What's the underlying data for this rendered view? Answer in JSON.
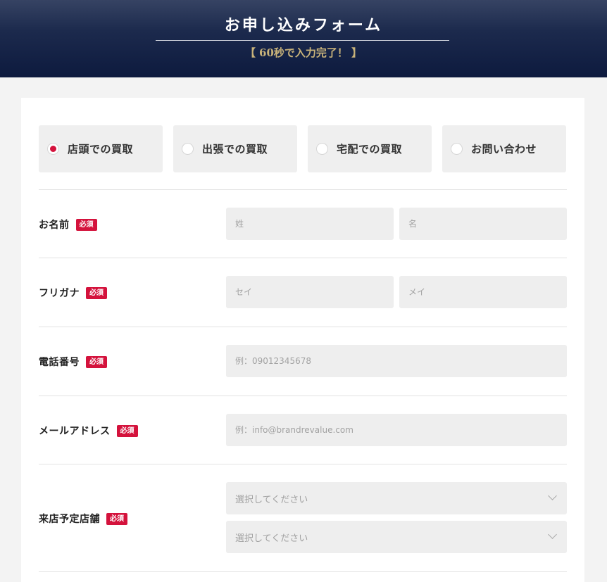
{
  "header": {
    "title": "お申し込みフォーム",
    "subtitle": "【 60秒で入力完了！ 】"
  },
  "options": [
    {
      "label": "店頭での買取",
      "selected": true
    },
    {
      "label": "出張での買取",
      "selected": false
    },
    {
      "label": "宅配での買取",
      "selected": false
    },
    {
      "label": "お問い合わせ",
      "selected": false
    }
  ],
  "required_badge": "必須",
  "fields": {
    "name": {
      "label": "お名前",
      "last_placeholder": "姓",
      "first_placeholder": "名"
    },
    "kana": {
      "label": "フリガナ",
      "last_placeholder": "セイ",
      "first_placeholder": "メイ"
    },
    "phone": {
      "label": "電話番号",
      "placeholder": "例：09012345678"
    },
    "email": {
      "label": "メールアドレス",
      "placeholder": "例：info@brandrevalue.com"
    },
    "store": {
      "label": "来店予定店舗",
      "select1": "選択してください",
      "select2": "選択してください"
    }
  },
  "colors": {
    "accent": "#d4123c",
    "header_bg": "#0d1a3e",
    "subtitle": "#c9b37a"
  }
}
